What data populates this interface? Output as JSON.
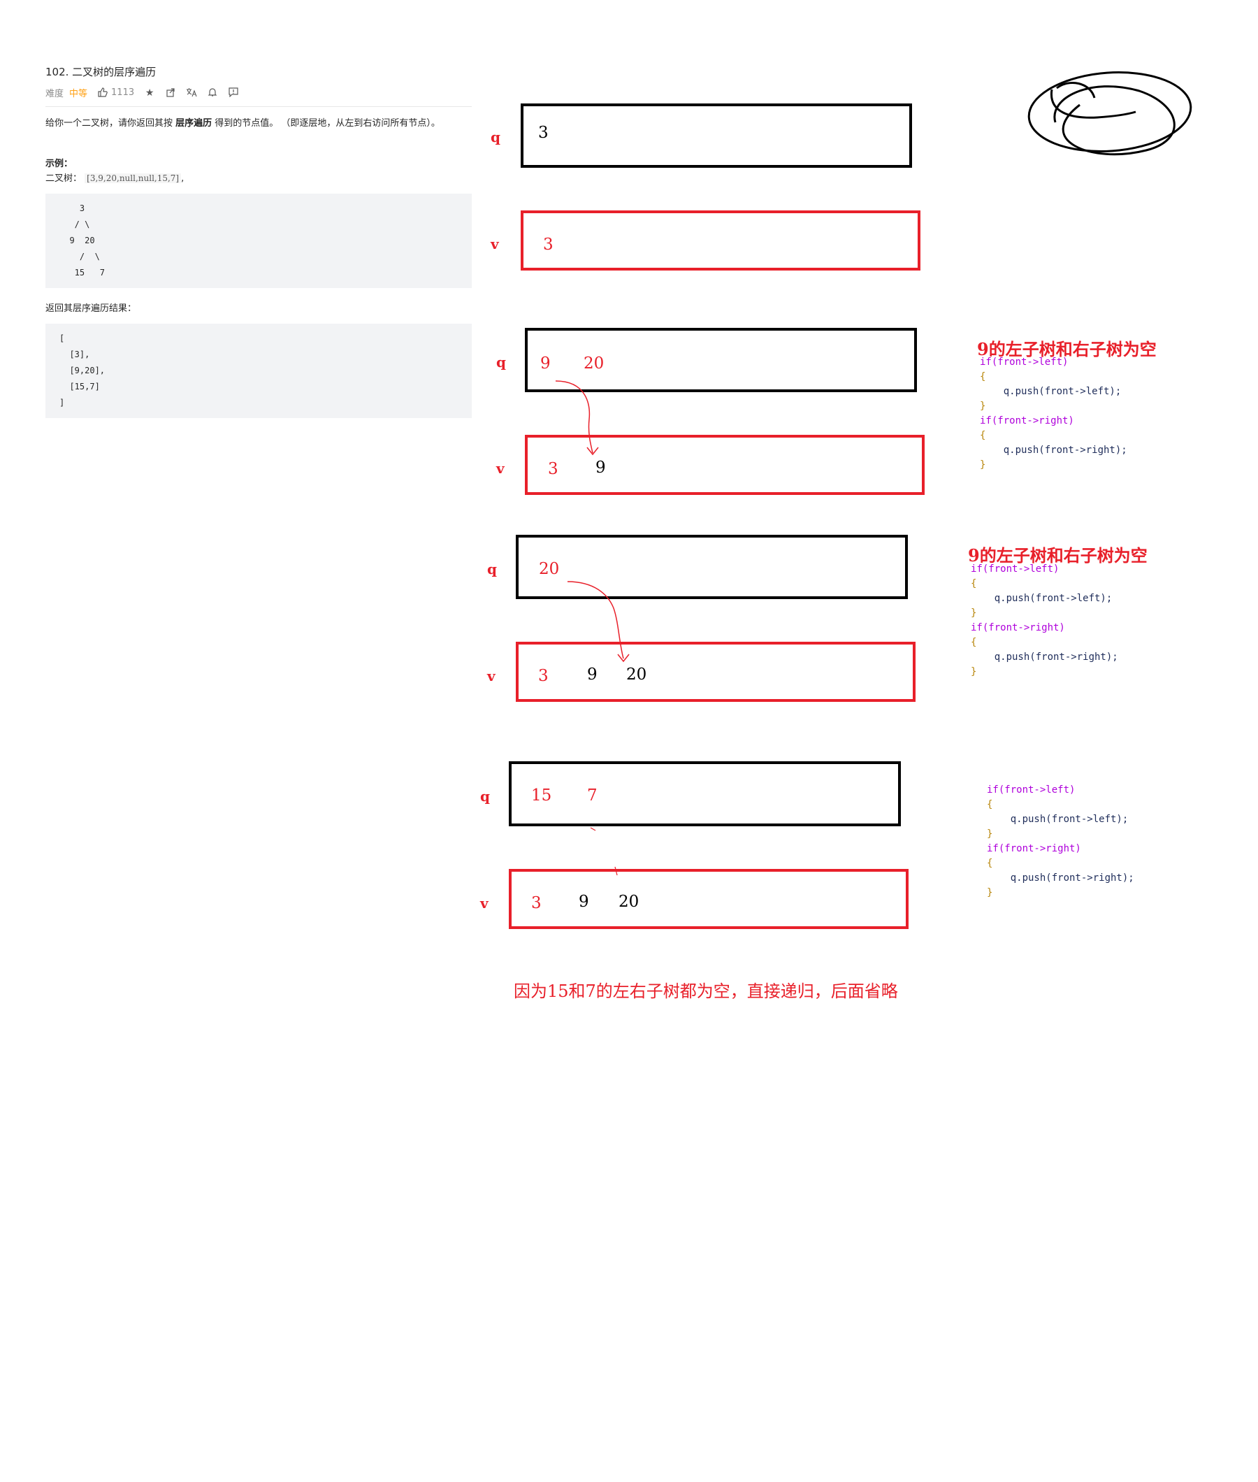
{
  "problem": {
    "title": "102. 二叉树的层序遍历",
    "difficulty_label": "难度",
    "difficulty": "中等",
    "likes": "1113",
    "desc_prefix": "给你一个二叉树，请你返回其按 ",
    "desc_bold": "层序遍历",
    "desc_suffix": " 得到的节点值。 （即逐层地，从左到右访问所有节点）。",
    "example_heading": "示例：",
    "example_label": "二叉树：",
    "example_input": "[3,9,20,null,null,15,7]",
    "example_input_tail": ",",
    "tree_lines": [
      "    3",
      "   / \\",
      "  9  20",
      "    /  \\",
      "   15   7"
    ],
    "result_heading": "返回其层序遍历结果：",
    "result_lines": [
      "[",
      "  [3],",
      "  [9,20],",
      "  [15,7]",
      "]"
    ]
  },
  "diagram": {
    "q_label": "q",
    "v_label": "v",
    "step1": {
      "q": [
        "3"
      ],
      "v": [
        "3"
      ]
    },
    "step2": {
      "q": [
        "9",
        "20"
      ],
      "v": [
        "3",
        "9"
      ]
    },
    "step3": {
      "q": [
        "20"
      ],
      "v": [
        "3",
        "9",
        "20"
      ]
    },
    "step4": {
      "q": [
        "15",
        "7"
      ],
      "v": [
        "3",
        "9",
        "20"
      ]
    },
    "note1_title": "9的左子树和右子树为空",
    "note2_title": "9的左子树和右子树为空",
    "code": {
      "line1": "if(front->left)",
      "line2": "{",
      "line3": "    q.push(front->left);",
      "line4": "}",
      "line5": "if(front->right)",
      "line6": "{",
      "line7": "    q.push(front->right);",
      "line8": "}"
    },
    "bottom_note": "因为15和7的左右子树都为空，直接递归，后面省略"
  },
  "colors": {
    "red": "#e8202a",
    "black": "#000000",
    "accent": "#ffa116"
  }
}
